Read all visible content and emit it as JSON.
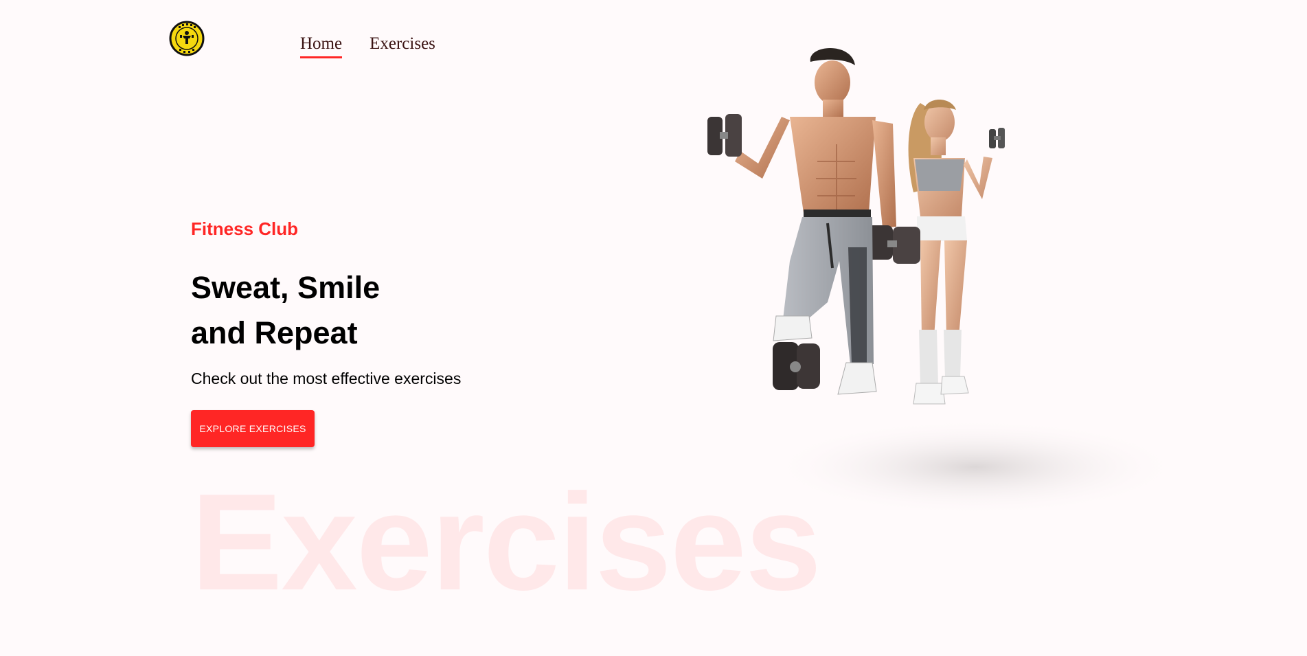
{
  "header": {
    "logo_icon": "gym-logo-icon",
    "nav": [
      {
        "label": "Home",
        "active": true
      },
      {
        "label": "Exercises",
        "active": false
      }
    ]
  },
  "hero": {
    "kicker": "Fitness Club",
    "title_line1": "Sweat, Smile",
    "title_line2": "and Repeat",
    "subtitle": "Check out the most effective exercises",
    "cta_label": "EXPLORE EXERCISES",
    "watermark": "Exercises",
    "image_icon": "fitness-couple-photo"
  },
  "colors": {
    "accent": "#ff2625",
    "background": "#fffafb",
    "nav_text": "#3a1212",
    "logo_yellow": "#f5d80f"
  }
}
